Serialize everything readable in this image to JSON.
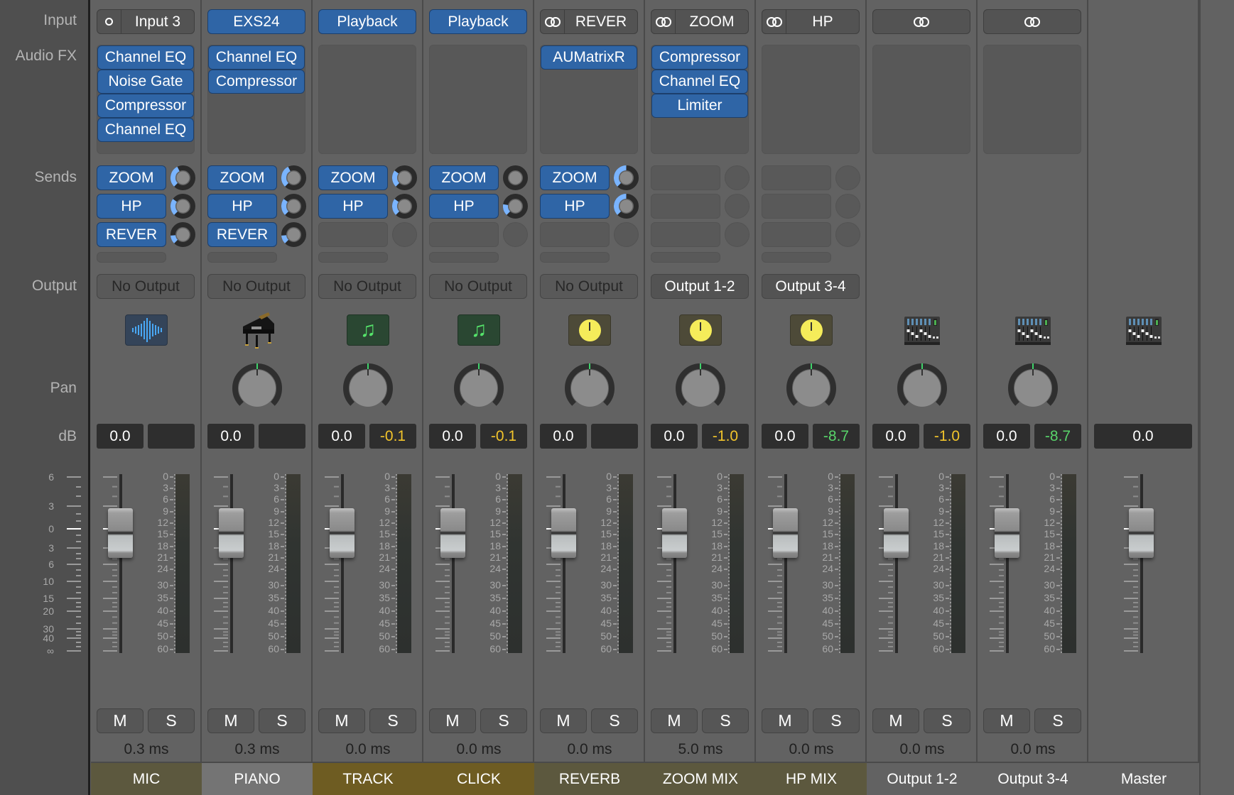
{
  "row_labels": {
    "input": "Input",
    "audio_fx": "Audio FX",
    "sends": "Sends",
    "output": "Output",
    "pan": "Pan",
    "db": "dB"
  },
  "fader_scale": {
    "labels": [
      "6",
      "3",
      "0",
      "3",
      "6",
      "10",
      "15",
      "20",
      "30",
      "40",
      "∞"
    ]
  },
  "meter_scale": {
    "labels": [
      "0",
      "3",
      "6",
      "9",
      "12",
      "15",
      "18",
      "21",
      "24",
      "30",
      "35",
      "40",
      "45",
      "50",
      "60"
    ]
  },
  "colors": {
    "plugin_blue": "#2f65a6",
    "send_level_blue": "#7ab4ff",
    "peak_yellow": "#f2c42b",
    "peak_green": "#58d46a",
    "pan_center_green": "#3fd36b"
  },
  "strips": [
    {
      "name": "MIC",
      "name_color": "#5c583e",
      "input": {
        "type": "mono",
        "label": "Input 3",
        "style": "dark",
        "icon": "mono-circle-icon"
      },
      "audio_fx": [
        "Channel EQ",
        "Noise Gate",
        "Compressor",
        "Channel EQ"
      ],
      "sends": [
        {
          "label": "ZOOM",
          "level": 0.4
        },
        {
          "label": "HP",
          "level": 0.3
        },
        {
          "label": "REVER",
          "level": 0.15
        }
      ],
      "send_slots": 3,
      "has_send_extra": true,
      "output": {
        "label": "No Output",
        "set": false
      },
      "icon": "audio-waveform-icon",
      "pan": null,
      "volume_db": "0.0",
      "peak_db": "",
      "peak_color": "none",
      "mute_label": "M",
      "solo_label": "S",
      "delay": "0.3 ms"
    },
    {
      "name": "PIANO",
      "name_color": "#747474",
      "input": {
        "type": "instrument",
        "label": "EXS24",
        "style": "blue"
      },
      "audio_fx": [
        "Channel EQ",
        "Compressor"
      ],
      "sends": [
        {
          "label": "ZOOM",
          "level": 0.4
        },
        {
          "label": "HP",
          "level": 0.3
        },
        {
          "label": "REVER",
          "level": 0.15
        }
      ],
      "send_slots": 3,
      "has_send_extra": true,
      "output": {
        "label": "No Output",
        "set": false
      },
      "icon": "grand-piano-icon",
      "pan": 0,
      "volume_db": "0.0",
      "peak_db": "",
      "peak_color": "none",
      "mute_label": "M",
      "solo_label": "S",
      "delay": "0.3 ms"
    },
    {
      "name": "TRACK",
      "name_color": "#6e5c22",
      "input": {
        "type": "playback",
        "label": "Playback",
        "style": "blue"
      },
      "audio_fx": [],
      "sends": [
        {
          "label": "ZOOM",
          "level": 0.3
        },
        {
          "label": "HP",
          "level": 0.3
        }
      ],
      "send_slots": 3,
      "has_send_extra": true,
      "output": {
        "label": "No Output",
        "set": false
      },
      "icon": "music-note-icon",
      "pan": 0,
      "volume_db": "0.0",
      "peak_db": "-0.1",
      "peak_color": "yellow",
      "mute_label": "M",
      "solo_label": "S",
      "delay": "0.0 ms"
    },
    {
      "name": "CLICK",
      "name_color": "#6e5c22",
      "input": {
        "type": "playback",
        "label": "Playback",
        "style": "blue"
      },
      "audio_fx": [],
      "sends": [
        {
          "label": "ZOOM",
          "level": 0.0
        },
        {
          "label": "HP",
          "level": 0.2
        }
      ],
      "send_slots": 3,
      "has_send_extra": true,
      "output": {
        "label": "No Output",
        "set": false
      },
      "icon": "music-note-icon",
      "pan": 0,
      "volume_db": "0.0",
      "peak_db": "-0.1",
      "peak_color": "yellow",
      "mute_label": "M",
      "solo_label": "S",
      "delay": "0.0 ms"
    },
    {
      "name": "REVERB",
      "name_color": "#5c583e",
      "input": {
        "type": "bus",
        "label": "REVER",
        "style": "dark",
        "icon": "stereo-link-icon"
      },
      "audio_fx": [
        "AUMatrixR"
      ],
      "sends": [
        {
          "label": "ZOOM",
          "level": 0.5
        },
        {
          "label": "HP",
          "level": 0.5
        }
      ],
      "send_slots": 3,
      "has_send_extra": true,
      "output": {
        "label": "No Output",
        "set": false
      },
      "icon": "aux-knob-icon",
      "pan": 0,
      "volume_db": "0.0",
      "peak_db": "",
      "peak_color": "none",
      "mute_label": "M",
      "solo_label": "S",
      "delay": "0.0 ms"
    },
    {
      "name": "ZOOM MIX",
      "name_color": "#5c583e",
      "input": {
        "type": "bus",
        "label": "ZOOM",
        "style": "dark",
        "icon": "stereo-link-icon"
      },
      "audio_fx": [
        "Compressor",
        "Channel EQ",
        "Limiter"
      ],
      "sends": [],
      "send_slots": 3,
      "has_send_extra": true,
      "output": {
        "label": "Output 1-2",
        "set": true
      },
      "icon": "aux-knob-icon",
      "pan": 0,
      "volume_db": "0.0",
      "peak_db": "-1.0",
      "peak_color": "yellow",
      "mute_label": "M",
      "solo_label": "S",
      "delay": "5.0 ms"
    },
    {
      "name": "HP MIX",
      "name_color": "#5c583e",
      "input": {
        "type": "bus",
        "label": "HP",
        "style": "dark",
        "icon": "stereo-link-icon"
      },
      "audio_fx": [],
      "sends": [],
      "send_slots": 3,
      "has_send_extra": true,
      "output": {
        "label": "Output 3-4",
        "set": true
      },
      "icon": "aux-knob-icon",
      "pan": 0,
      "volume_db": "0.0",
      "peak_db": "-8.7",
      "peak_color": "green",
      "mute_label": "M",
      "solo_label": "S",
      "delay": "0.0 ms"
    },
    {
      "name": "Output 1-2",
      "name_color": "#626262",
      "input": {
        "type": "output",
        "label": "",
        "style": "dark",
        "icon": "stereo-link-icon"
      },
      "audio_fx": [],
      "sends": [],
      "send_slots": 0,
      "has_send_extra": false,
      "output": null,
      "icon": "mixer-console-icon",
      "pan": 0,
      "volume_db": "0.0",
      "peak_db": "-1.0",
      "peak_color": "yellow",
      "mute_label": "M",
      "solo_label": "S",
      "delay": "0.0 ms"
    },
    {
      "name": "Output 3-4",
      "name_color": "#626262",
      "input": {
        "type": "output",
        "label": "",
        "style": "dark",
        "icon": "stereo-link-icon"
      },
      "audio_fx": [],
      "sends": [],
      "send_slots": 0,
      "has_send_extra": false,
      "output": null,
      "icon": "mixer-console-icon",
      "pan": 0,
      "volume_db": "0.0",
      "peak_db": "-8.7",
      "peak_color": "green",
      "mute_label": "M",
      "solo_label": "S",
      "delay": "0.0 ms"
    },
    {
      "name": "Master",
      "name_color": "#626262",
      "input": null,
      "audio_fx": null,
      "sends": [],
      "send_slots": 0,
      "has_send_extra": false,
      "output": null,
      "icon": "mixer-console-icon",
      "pan": null,
      "volume_db": "0.0",
      "peak_db": null,
      "peak_color": "none",
      "mute_label": null,
      "solo_label": null,
      "delay": null,
      "master": true
    }
  ]
}
